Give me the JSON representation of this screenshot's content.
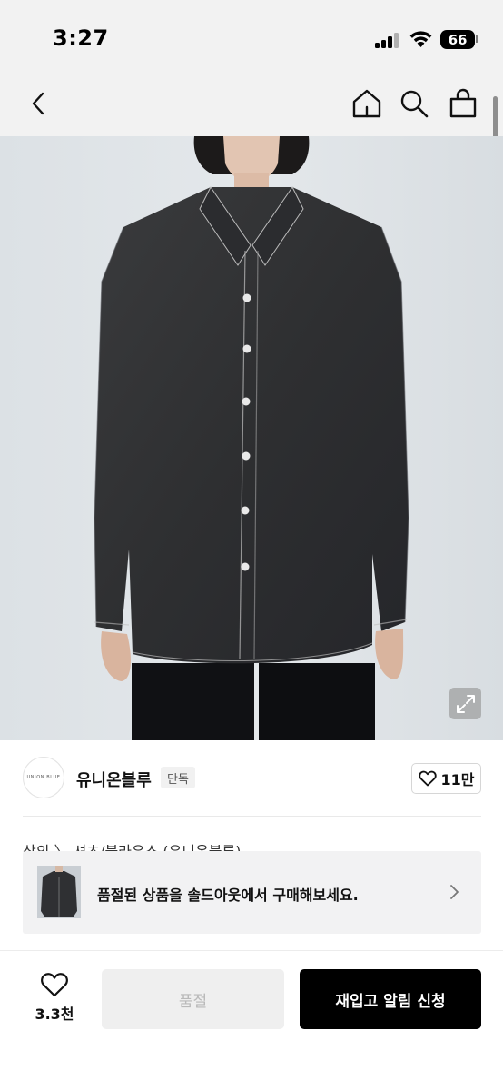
{
  "status_bar": {
    "time": "3:27",
    "battery": "66"
  },
  "nav": {
    "back_icon": "chevron-left-icon",
    "home_icon": "home-icon",
    "search_icon": "search-icon",
    "bag_icon": "shopping-bag-icon"
  },
  "product": {
    "image_description": "dark denim long-sleeve shirt",
    "expand_icon": "expand-icon"
  },
  "brand": {
    "logo_text": "UNION BLUE",
    "name": "유니온블루",
    "badge": "단독",
    "likes": "11만"
  },
  "category": {
    "text": "상의 〉 셔츠/블라우스 (유니온블루)"
  },
  "banner": {
    "text": "품절된 상품을 솔드아웃에서 구매해보세요."
  },
  "bottom_bar": {
    "wish_count": "3.3천",
    "soldout_label": "품절",
    "restock_label": "재입고 알림 신청"
  },
  "colors": {
    "accent": "#000000",
    "disabled_bg": "#efefef",
    "disabled_text": "#b9b9b9"
  }
}
